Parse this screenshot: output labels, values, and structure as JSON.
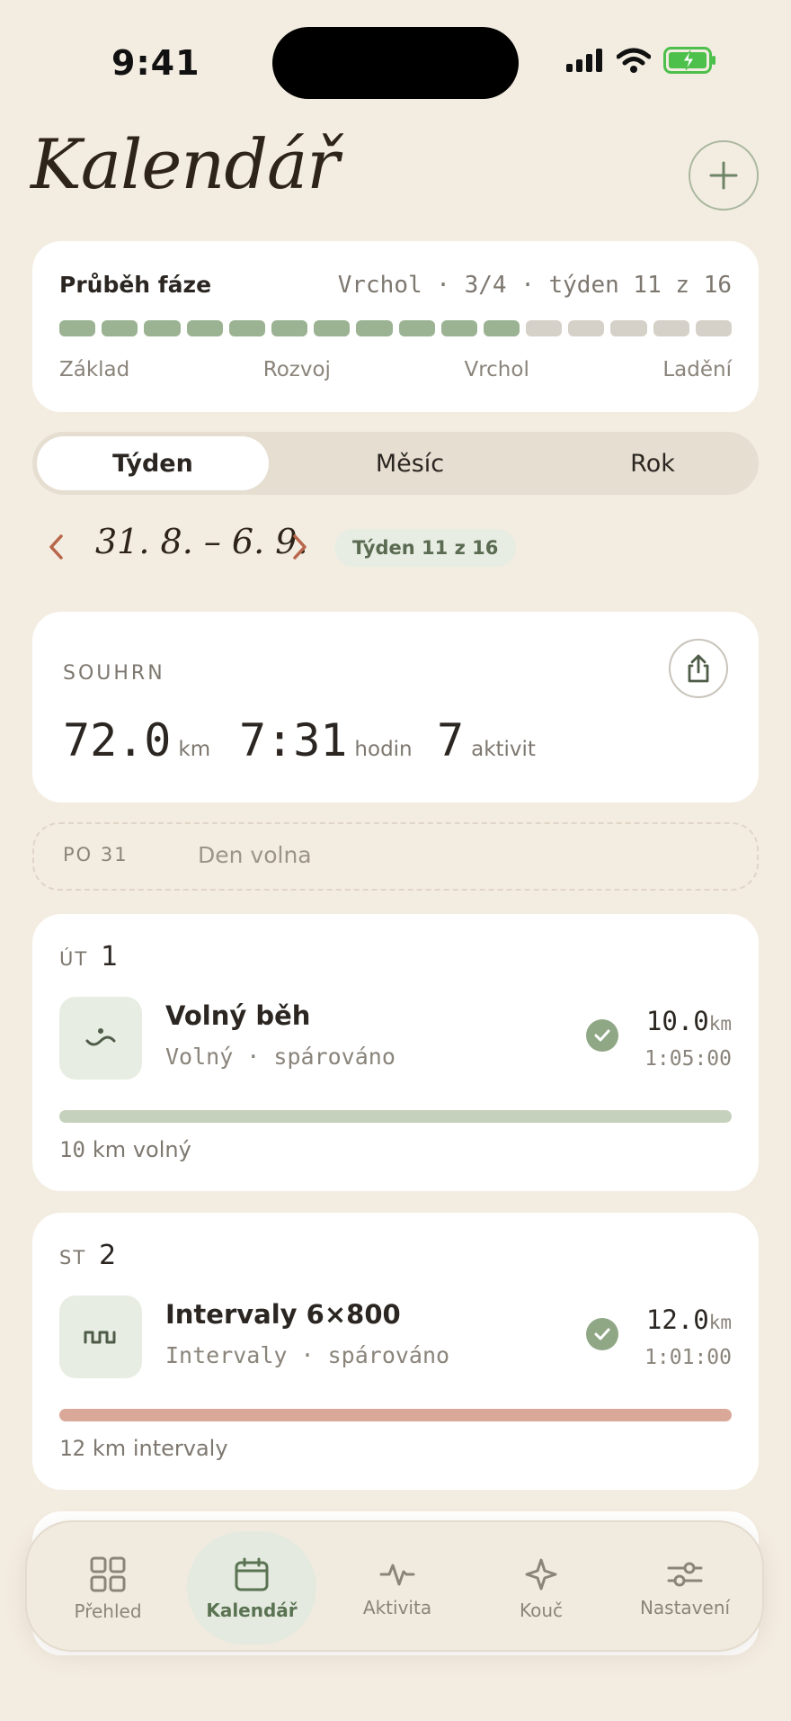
{
  "status_bar": {
    "time": "9:41"
  },
  "header": {
    "title": "Kalendář",
    "add_icon": "plus-icon"
  },
  "phase": {
    "title": "Průběh fáze",
    "meta": "Vrchol · 3/4 · týden 11 z 16",
    "total_weeks": 16,
    "completed_weeks": 11,
    "labels": [
      "Základ",
      "Rozvoj",
      "Vrchol",
      "Ladění"
    ],
    "colors": {
      "done": "#9BB392",
      "pending": "#D6D1C8"
    }
  },
  "tabs_range": {
    "items": [
      "Týden",
      "Měsíc",
      "Rok"
    ],
    "selected": "Týden"
  },
  "week_nav": {
    "range": "31. 8. – 6. 9.",
    "badge": "Týden 11 z 16"
  },
  "summary": {
    "label": "SOUHRN",
    "distance": {
      "value": "72.0",
      "unit": "km"
    },
    "time": {
      "value": "7:31",
      "unit": "hodin"
    },
    "activities": {
      "value": "7",
      "unit": "aktivit"
    }
  },
  "rest_day": {
    "day": "PO 31",
    "text": "Den volna"
  },
  "workouts": [
    {
      "day_abbr": "ÚT",
      "day_num": "1",
      "icon": "wave-icon",
      "name": "Volný běh",
      "sub": "Volný · spárováno",
      "distance": "10.0",
      "unit": "km",
      "time": "1:05:00",
      "note_num": "10",
      "note_text": "km volný",
      "bar_color": "#C5D1BD"
    },
    {
      "day_abbr": "ST",
      "day_num": "2",
      "icon": "intervals-icon",
      "name": "Intervaly 6×800",
      "sub": "Intervaly · spárováno",
      "distance": "12.0",
      "unit": "km",
      "time": "1:01:00",
      "note_num": "12",
      "note_text": "km intervaly",
      "bar_color": "#D9A898"
    }
  ],
  "tab_bar": [
    {
      "label": "Přehled",
      "icon": "grid-icon",
      "active": false
    },
    {
      "label": "Kalendář",
      "icon": "calendar-icon",
      "active": true
    },
    {
      "label": "Aktivita",
      "icon": "pulse-icon",
      "active": false
    },
    {
      "label": "Kouč",
      "icon": "sparkle-icon",
      "active": false
    },
    {
      "label": "Nastavení",
      "icon": "sliders-icon",
      "active": false
    }
  ],
  "colors": {
    "background": "#F3ECE1",
    "accent_green": "#8FA785",
    "accent_orange": "#B8664A"
  }
}
